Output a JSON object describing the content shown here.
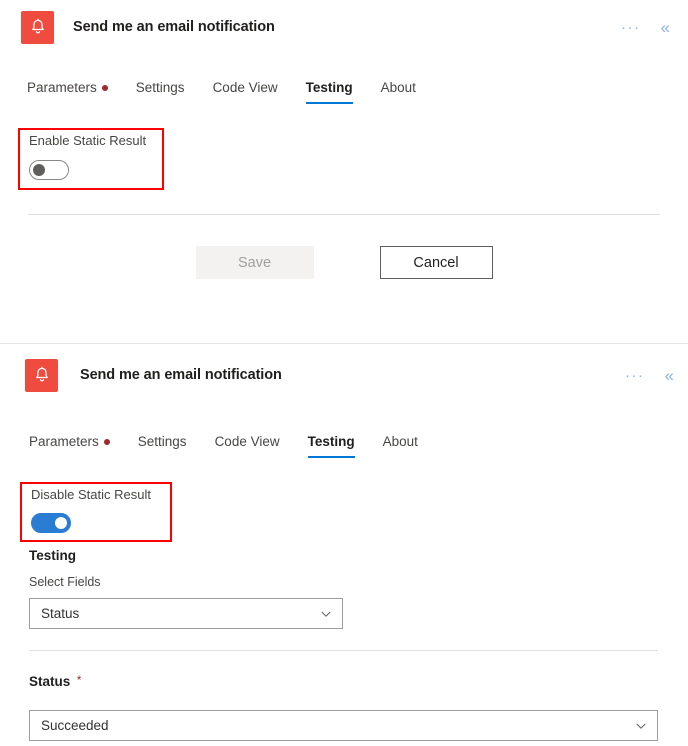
{
  "panels": [
    {
      "header": {
        "icon": "bell-icon",
        "icon_color": "#f04b3f",
        "title": "Send me an email notification",
        "overflow_label": "···",
        "collapse_label": "«"
      },
      "tabs": [
        {
          "label": "Parameters",
          "has_dot": true,
          "active": false
        },
        {
          "label": "Settings",
          "has_dot": false,
          "active": false
        },
        {
          "label": "Code View",
          "has_dot": false,
          "active": false
        },
        {
          "label": "Testing",
          "has_dot": false,
          "active": true
        },
        {
          "label": "About",
          "has_dot": false,
          "active": false
        }
      ],
      "static_result": {
        "label": "Enable Static Result",
        "toggle_state": "off"
      },
      "buttons": {
        "save_label": "Save",
        "cancel_label": "Cancel"
      }
    },
    {
      "header": {
        "icon": "bell-icon",
        "icon_color": "#f04b3f",
        "title": "Send me an email notification",
        "overflow_label": "···",
        "collapse_label": "«"
      },
      "tabs": [
        {
          "label": "Parameters",
          "has_dot": true,
          "active": false
        },
        {
          "label": "Settings",
          "has_dot": false,
          "active": false
        },
        {
          "label": "Code View",
          "has_dot": false,
          "active": false
        },
        {
          "label": "Testing",
          "has_dot": false,
          "active": true
        },
        {
          "label": "About",
          "has_dot": false,
          "active": false
        }
      ],
      "static_result": {
        "label": "Disable Static Result",
        "toggle_state": "on"
      },
      "testing": {
        "section_title": "Testing",
        "select_fields_label": "Select Fields",
        "select_fields_value": "Status",
        "status_label": "Status",
        "status_required_marker": "*",
        "status_value": "Succeeded"
      }
    }
  ],
  "colors": {
    "accent": "#0078d4",
    "brand_red": "#f04b3f",
    "highlight_red": "#ff0000",
    "required_red": "#a4262c",
    "toggle_on": "#2b7cd3"
  }
}
